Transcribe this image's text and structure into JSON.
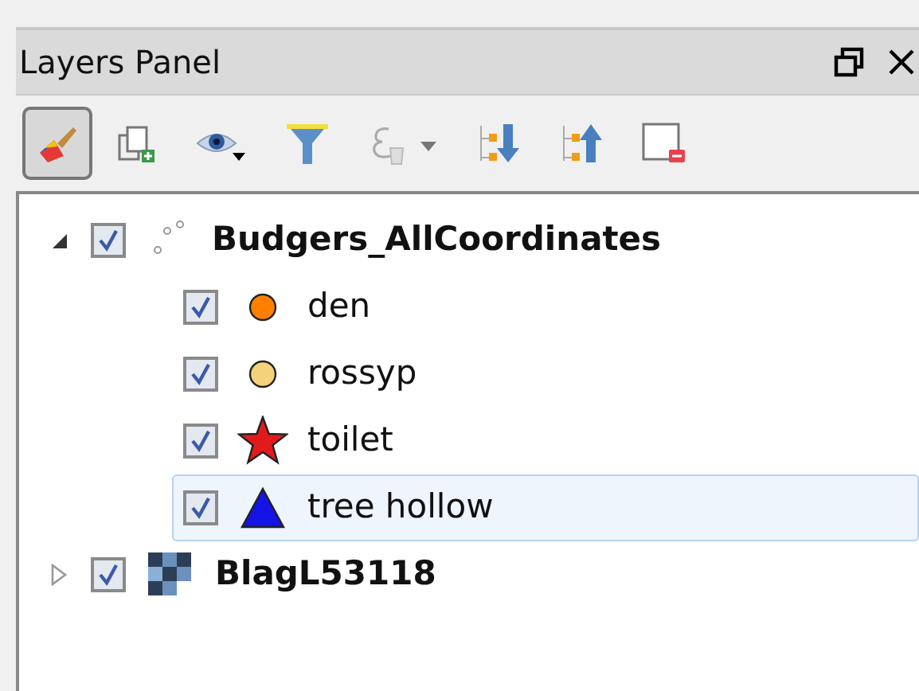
{
  "panel": {
    "title": "Layers Panel"
  },
  "toolbar": [
    {
      "kind": "style",
      "selected": true
    },
    {
      "kind": "add-group",
      "selected": false
    },
    {
      "kind": "visibility",
      "selected": false
    },
    {
      "kind": "filter",
      "selected": false
    },
    {
      "kind": "expression",
      "selected": false
    },
    {
      "kind": "expand",
      "selected": false
    },
    {
      "kind": "collapse",
      "selected": false
    },
    {
      "kind": "remove",
      "selected": false
    }
  ],
  "layers": [
    {
      "name": "Budgers_AllCoordinates",
      "kind": "points",
      "checked": true,
      "expanded": true,
      "selected": false,
      "children": [
        {
          "name": "den",
          "kind": "dot",
          "color": "#ff7f00",
          "checked": true,
          "selected": false
        },
        {
          "name": "rossyp",
          "kind": "dot",
          "color": "#f3d27b",
          "checked": true,
          "selected": false
        },
        {
          "name": "toilet",
          "kind": "star",
          "color": "#e31a1c",
          "checked": true,
          "selected": false
        },
        {
          "name": "tree hollow",
          "kind": "triangle",
          "color": "#1414e6",
          "checked": true,
          "selected": true
        }
      ]
    },
    {
      "name": "BlagL53118",
      "kind": "raster",
      "checked": true,
      "expanded": false,
      "selected": false
    }
  ]
}
